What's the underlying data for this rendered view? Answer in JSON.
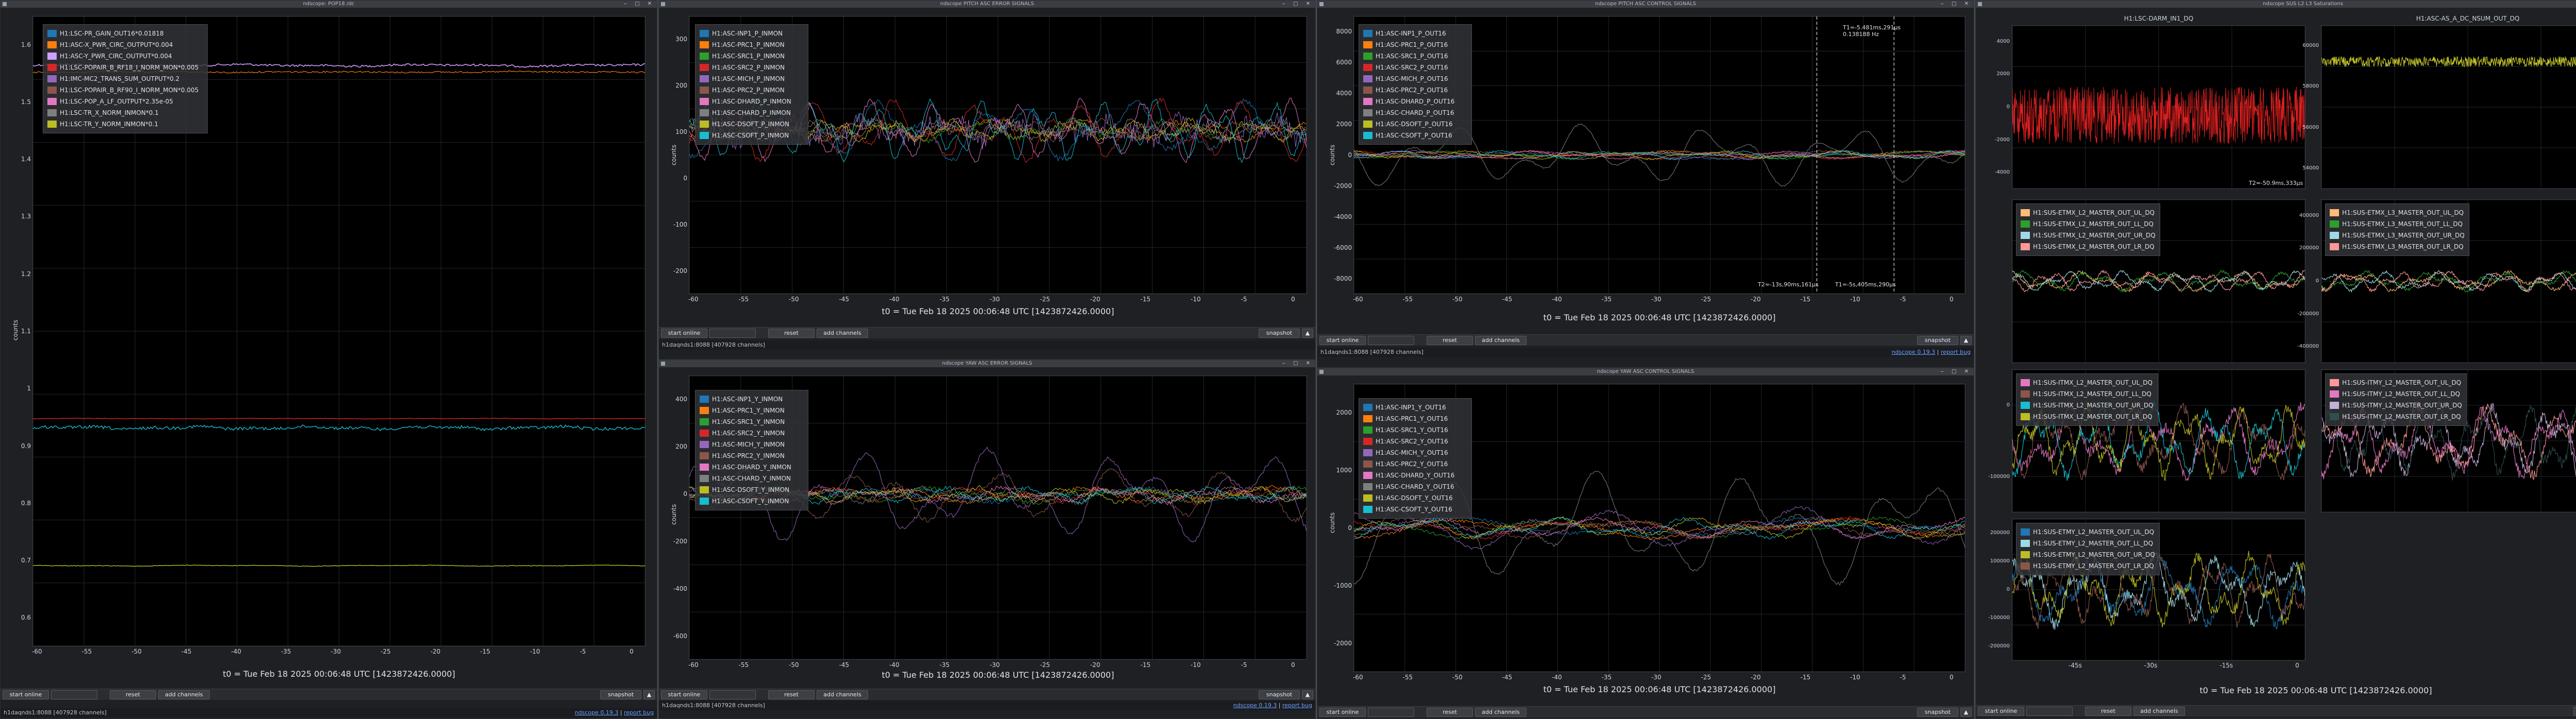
{
  "colors": {
    "bg": "#1e2024",
    "plot_bg": "#000000",
    "grid": "#262a30",
    "legend_bg": "#323438"
  },
  "windows": [
    {
      "id": "w1",
      "title": "ndscope: POP18 /dc",
      "legend": [
        {
          "label": "H1:LSC-PR_GAIN_OUT16*0.01818",
          "color": "#1f77b4"
        },
        {
          "label": "H1:ASC-X_PWR_CIRC_OUTPUT*0.004",
          "color": "#ff7f0e"
        },
        {
          "label": "H1:ASC-Y_PWR_CIRC_OUTPUT*0.004",
          "color": "#d0a0ff"
        },
        {
          "label": "H1:LSC-POPAIR_B_RF18_I_NORM_MON*0.005",
          "color": "#d62728"
        },
        {
          "label": "H1:IMC-MC2_TRANS_SUM_OUTPUT*0.2",
          "color": "#9467bd"
        },
        {
          "label": "H1:LSC-POPAIR_B_RF90_I_NORM_MON*0.005",
          "color": "#8c564b"
        },
        {
          "label": "H1:LSC-POP_A_LF_OUTPUT*2.35e-05",
          "color": "#e377c2"
        },
        {
          "label": "H1:LSC-TR_X_NORM_INMON*0.1",
          "color": "#7f7f7f"
        },
        {
          "label": "H1:LSC-TR_Y_NORM_INMON*0.1",
          "color": "#bcbd22"
        }
      ],
      "yticks": [
        "1.6",
        "1.5",
        "1.4",
        "1.3",
        "1.2",
        "1.1",
        "1",
        "0.9",
        "0.8",
        "0.7",
        "0.6"
      ],
      "xticks": [
        "-60",
        "-55",
        "-50",
        "-45",
        "-40",
        "-35",
        "-30",
        "-25",
        "-20",
        "-15",
        "-10",
        "-5",
        "0"
      ],
      "ylabel": "counts",
      "t0": "t0 = Tue Feb 18 2025 00:06:48 UTC [1423872426.0000]",
      "buttons": {
        "start": "start online",
        "mid": "",
        "reset": "reset",
        "add": "add channels",
        "snapshot": "snapshot"
      },
      "status_left": "h1daqnds1:8088  [407928 channels]",
      "status_right": "ndscope 0.19.3",
      "status_bug": "report bug"
    },
    {
      "id": "w2",
      "title": "ndscope PITCH ASC ERROR SIGNALS",
      "legend": [
        {
          "label": "H1:ASC-INP1_P_INMON",
          "color": "#1f77b4"
        },
        {
          "label": "H1:ASC-PRC1_P_INMON",
          "color": "#ff7f0e"
        },
        {
          "label": "H1:ASC-SRC1_P_INMON",
          "color": "#2ca02c"
        },
        {
          "label": "H1:ASC-SRC2_P_INMON",
          "color": "#d62728"
        },
        {
          "label": "H1:ASC-MICH_P_INMON",
          "color": "#9467bd"
        },
        {
          "label": "H1:ASC-PRC2_P_INMON",
          "color": "#8c564b"
        },
        {
          "label": "H1:ASC-DHARD_P_INMON",
          "color": "#e377c2"
        },
        {
          "label": "H1:ASC-CHARD_P_INMON",
          "color": "#7f7f7f"
        },
        {
          "label": "H1:ASC-DSOFT_P_INMON",
          "color": "#bcbd22"
        },
        {
          "label": "H1:ASC-CSOFT_P_INMON",
          "color": "#17becf"
        }
      ],
      "yticks": [
        "300",
        "200",
        "100",
        "0",
        "-100",
        "-200"
      ],
      "xticks": [
        "-60",
        "-55",
        "-50",
        "-45",
        "-40",
        "-35",
        "-30",
        "-25",
        "-20",
        "-15",
        "-10",
        "-5",
        "0"
      ],
      "ylabel": "counts",
      "t0": "t0 = Tue Feb 18 2025 00:06:48 UTC [1423872426.0000]",
      "buttons": {
        "start": "start online",
        "mid": "",
        "reset": "reset",
        "add": "add channels",
        "snapshot": "snapshot"
      },
      "status_left": "h1daqnds1:8088  [407928 channels]",
      "status_right": "ndscope 0.19.3",
      "status_bug": "report bug"
    },
    {
      "id": "w3",
      "title": "ndscope YAW ASC ERROR SIGNALS",
      "legend": [
        {
          "label": "H1:ASC-INP1_Y_INMON",
          "color": "#1f77b4"
        },
        {
          "label": "H1:ASC-PRC1_Y_INMON",
          "color": "#ff7f0e"
        },
        {
          "label": "H1:ASC-SRC1_Y_INMON",
          "color": "#2ca02c"
        },
        {
          "label": "H1:ASC-SRC2_Y_INMON",
          "color": "#d62728"
        },
        {
          "label": "H1:ASC-MICH_Y_INMON",
          "color": "#9467bd"
        },
        {
          "label": "H1:ASC-PRC2_Y_INMON",
          "color": "#8c564b"
        },
        {
          "label": "H1:ASC-DHARD_Y_INMON",
          "color": "#e377c2"
        },
        {
          "label": "H1:ASC-CHARD_Y_INMON",
          "color": "#7f7f7f"
        },
        {
          "label": "H1:ASC-DSOFT_Y_INMON",
          "color": "#bcbd22"
        },
        {
          "label": "H1:ASC-CSOFT_Y_INMON",
          "color": "#17becf"
        }
      ],
      "yticks": [
        "400",
        "200",
        "0",
        "-200",
        "-400",
        "-600"
      ],
      "xticks": [
        "-60",
        "-55",
        "-50",
        "-45",
        "-40",
        "-35",
        "-30",
        "-25",
        "-20",
        "-15",
        "-10",
        "-5",
        "0"
      ],
      "ylabel": "counts",
      "t0": "t0 = Tue Feb 18 2025 00:06:48 UTC [1423872426.0000]",
      "buttons": {
        "start": "start online",
        "mid": "",
        "reset": "reset",
        "add": "add channels",
        "snapshot": "snapshot"
      },
      "status_left": "h1daqnds1:8088  [407928 channels]",
      "status_right": "ndscope 0.19.3",
      "status_bug": "report bug"
    },
    {
      "id": "w4",
      "title": "ndscope PITCH ASC CONTROL SIGNALS",
      "legend": [
        {
          "label": "H1:ASC-INP1_P_OUT16",
          "color": "#1f77b4"
        },
        {
          "label": "H1:ASC-PRC1_P_OUT16",
          "color": "#ff7f0e"
        },
        {
          "label": "H1:ASC-SRC1_P_OUT16",
          "color": "#2ca02c"
        },
        {
          "label": "H1:ASC-SRC2_P_OUT16",
          "color": "#d62728"
        },
        {
          "label": "H1:ASC-MICH_P_OUT16",
          "color": "#9467bd"
        },
        {
          "label": "H1:ASC-PRC2_P_OUT16",
          "color": "#8c564b"
        },
        {
          "label": "H1:ASC-DHARD_P_OUT16",
          "color": "#e377c2"
        },
        {
          "label": "H1:ASC-CHARD_P_OUT16",
          "color": "#7f7f7f"
        },
        {
          "label": "H1:ASC-DSOFT_P_OUT16",
          "color": "#bcbd22"
        },
        {
          "label": "H1:ASC-CSOFT_P_OUT16",
          "color": "#17becf"
        }
      ],
      "yticks": [
        "8000",
        "6000",
        "4000",
        "2000",
        "0",
        "-2000",
        "-4000",
        "-6000",
        "-8000"
      ],
      "xticks": [
        "-60",
        "-55",
        "-50",
        "-45",
        "-40",
        "-35",
        "-30",
        "-25",
        "-20",
        "-15",
        "-10",
        "-5",
        "0"
      ],
      "ylabel": "counts",
      "t0": "t0 = Tue Feb 18 2025 00:06:48 UTC [1423872426.0000]",
      "cursor_annot": "T1=-5.481ms,291μs\n0.138188 Hz",
      "cursor_annot2": "T2=-13s,90ms,161μs",
      "cursor_annot3": "T1=-5s,405ms,290μs",
      "buttons": {
        "start": "start online",
        "mid": "",
        "reset": "reset",
        "add": "add channels",
        "snapshot": "snapshot"
      },
      "status_left": "h1daqnds1:8088  [407928 channels]",
      "status_right": "ndscope 0.19.3",
      "status_bug": "report bug"
    },
    {
      "id": "w5",
      "title": "ndscope YAW ASC CONTROL SIGNALS",
      "legend": [
        {
          "label": "H1:ASC-INP1_Y_OUT16",
          "color": "#1f77b4"
        },
        {
          "label": "H1:ASC-PRC1_Y_OUT16",
          "color": "#ff7f0e"
        },
        {
          "label": "H1:ASC-SRC1_Y_OUT16",
          "color": "#2ca02c"
        },
        {
          "label": "H1:ASC-SRC2_Y_OUT16",
          "color": "#d62728"
        },
        {
          "label": "H1:ASC-MICH_Y_OUT16",
          "color": "#9467bd"
        },
        {
          "label": "H1:ASC-PRC2_Y_OUT16",
          "color": "#8c564b"
        },
        {
          "label": "H1:ASC-DHARD_Y_OUT16",
          "color": "#e377c2"
        },
        {
          "label": "H1:ASC-CHARD_Y_OUT16",
          "color": "#7f7f7f"
        },
        {
          "label": "H1:ASC-DSOFT_Y_OUT16",
          "color": "#bcbd22"
        },
        {
          "label": "H1:ASC-CSOFT_Y_OUT16",
          "color": "#17becf"
        }
      ],
      "yticks": [
        "2000",
        "1000",
        "0",
        "-1000",
        "-2000"
      ],
      "xticks": [
        "-60",
        "-55",
        "-50",
        "-45",
        "-40",
        "-35",
        "-30",
        "-25",
        "-20",
        "-15",
        "-10",
        "-5",
        "0"
      ],
      "ylabel": "counts",
      "t0": "t0 = Tue Feb 18 2025 00:06:48 UTC [1423872426.0000]",
      "buttons": {
        "start": "start online",
        "mid": "",
        "reset": "reset",
        "add": "add channels",
        "snapshot": "snapshot"
      },
      "status_left": "",
      "status_right": "",
      "status_bug": ""
    },
    {
      "id": "w6",
      "title": "ndscope SUS L2 L3 Saturations",
      "sub": [
        {
          "title": "H1:LSC-DARM_IN1_DQ",
          "yticks": [
            "4000",
            "2000",
            "0",
            "-2000",
            "-4000"
          ],
          "legend": [],
          "annot": "T2=-50.9ms,333μs"
        },
        {
          "title": "H1:ASC-AS_A_DC_NSUM_OUT_DQ",
          "yticks": [
            "60000",
            "58000",
            "56000",
            "54000"
          ],
          "legend": []
        },
        {
          "title": "",
          "yticks": [
            "",
            "",
            "",
            ""
          ],
          "legend": [
            {
              "label": "H1:SUS-ETMX_L2_MASTER_OUT_UL_DQ",
              "color": "#ffbb78"
            },
            {
              "label": "H1:SUS-ETMX_L2_MASTER_OUT_LL_DQ",
              "color": "#2ca02c"
            },
            {
              "label": "H1:SUS-ETMX_L2_MASTER_OUT_UR_DQ",
              "color": "#9edae5"
            },
            {
              "label": "H1:SUS-ETMX_L2_MASTER_OUT_LR_DQ",
              "color": "#ff9896"
            }
          ]
        },
        {
          "title": "",
          "yticks": [
            "400000",
            "200000",
            "0",
            "-200000",
            "-400000"
          ],
          "legend": [
            {
              "label": "H1:SUS-ETMX_L3_MASTER_OUT_UL_DQ",
              "color": "#ffbb78"
            },
            {
              "label": "H1:SUS-ETMX_L3_MASTER_OUT_LL_DQ",
              "color": "#2ca02c"
            },
            {
              "label": "H1:SUS-ETMX_L3_MASTER_OUT_UR_DQ",
              "color": "#9edae5"
            },
            {
              "label": "H1:SUS-ETMX_L3_MASTER_OUT_LR_DQ",
              "color": "#ff9896"
            }
          ]
        },
        {
          "title": "",
          "yticks": [
            "0",
            "-100000"
          ],
          "legend": [
            {
              "label": "H1:SUS-ITMX_L2_MASTER_OUT_UL_DQ",
              "color": "#e377c2"
            },
            {
              "label": "H1:SUS-ITMX_L2_MASTER_OUT_LL_DQ",
              "color": "#8c564b"
            },
            {
              "label": "H1:SUS-ITMX_L2_MASTER_OUT_UR_DQ",
              "color": "#17becf"
            },
            {
              "label": "H1:SUS-ITMX_L2_MASTER_OUT_LR_DQ",
              "color": "#bcbd22"
            }
          ]
        },
        {
          "title": "",
          "yticks": [],
          "legend": [
            {
              "label": "H1:SUS-ITMY_L2_MASTER_OUT_UL_DQ",
              "color": "#ff9896"
            },
            {
              "label": "H1:SUS-ITMY_L2_MASTER_OUT_LL_DQ",
              "color": "#e377c2"
            },
            {
              "label": "H1:SUS-ITMY_L2_MASTER_OUT_UR_DQ",
              "color": "#c5b0d5"
            },
            {
              "label": "H1:SUS-ITMY_L2_MASTER_OUT_LR_DQ",
              "color": "#2f4f4f"
            }
          ]
        },
        {
          "title": "",
          "yticks": [
            "200000",
            "100000",
            "0",
            "-100000",
            "-200000"
          ],
          "legend": [
            {
              "label": "H1:SUS-ETMY_L2_MASTER_OUT_UL_DQ",
              "color": "#1f77b4"
            },
            {
              "label": "H1:SUS-ETMY_L2_MASTER_OUT_LL_DQ",
              "color": "#9edae5"
            },
            {
              "label": "H1:SUS-ETMY_L2_MASTER_OUT_UR_DQ",
              "color": "#bcbd22"
            },
            {
              "label": "H1:SUS-ETMY_L2_MASTER_OUT_LR_DQ",
              "color": "#8c564b"
            }
          ]
        }
      ],
      "xticks": [
        "-45s",
        "-30s",
        "-15s",
        "0"
      ],
      "t0": "t0 = Tue Feb 18 2025 00:06:48 UTC [1423872426.0000]",
      "buttons": {
        "start": "start online",
        "mid": "",
        "reset": "reset",
        "add": "add channels",
        "snapshot": "snapshot"
      },
      "status_left": "",
      "status_right": "",
      "status_bug": ""
    }
  ]
}
